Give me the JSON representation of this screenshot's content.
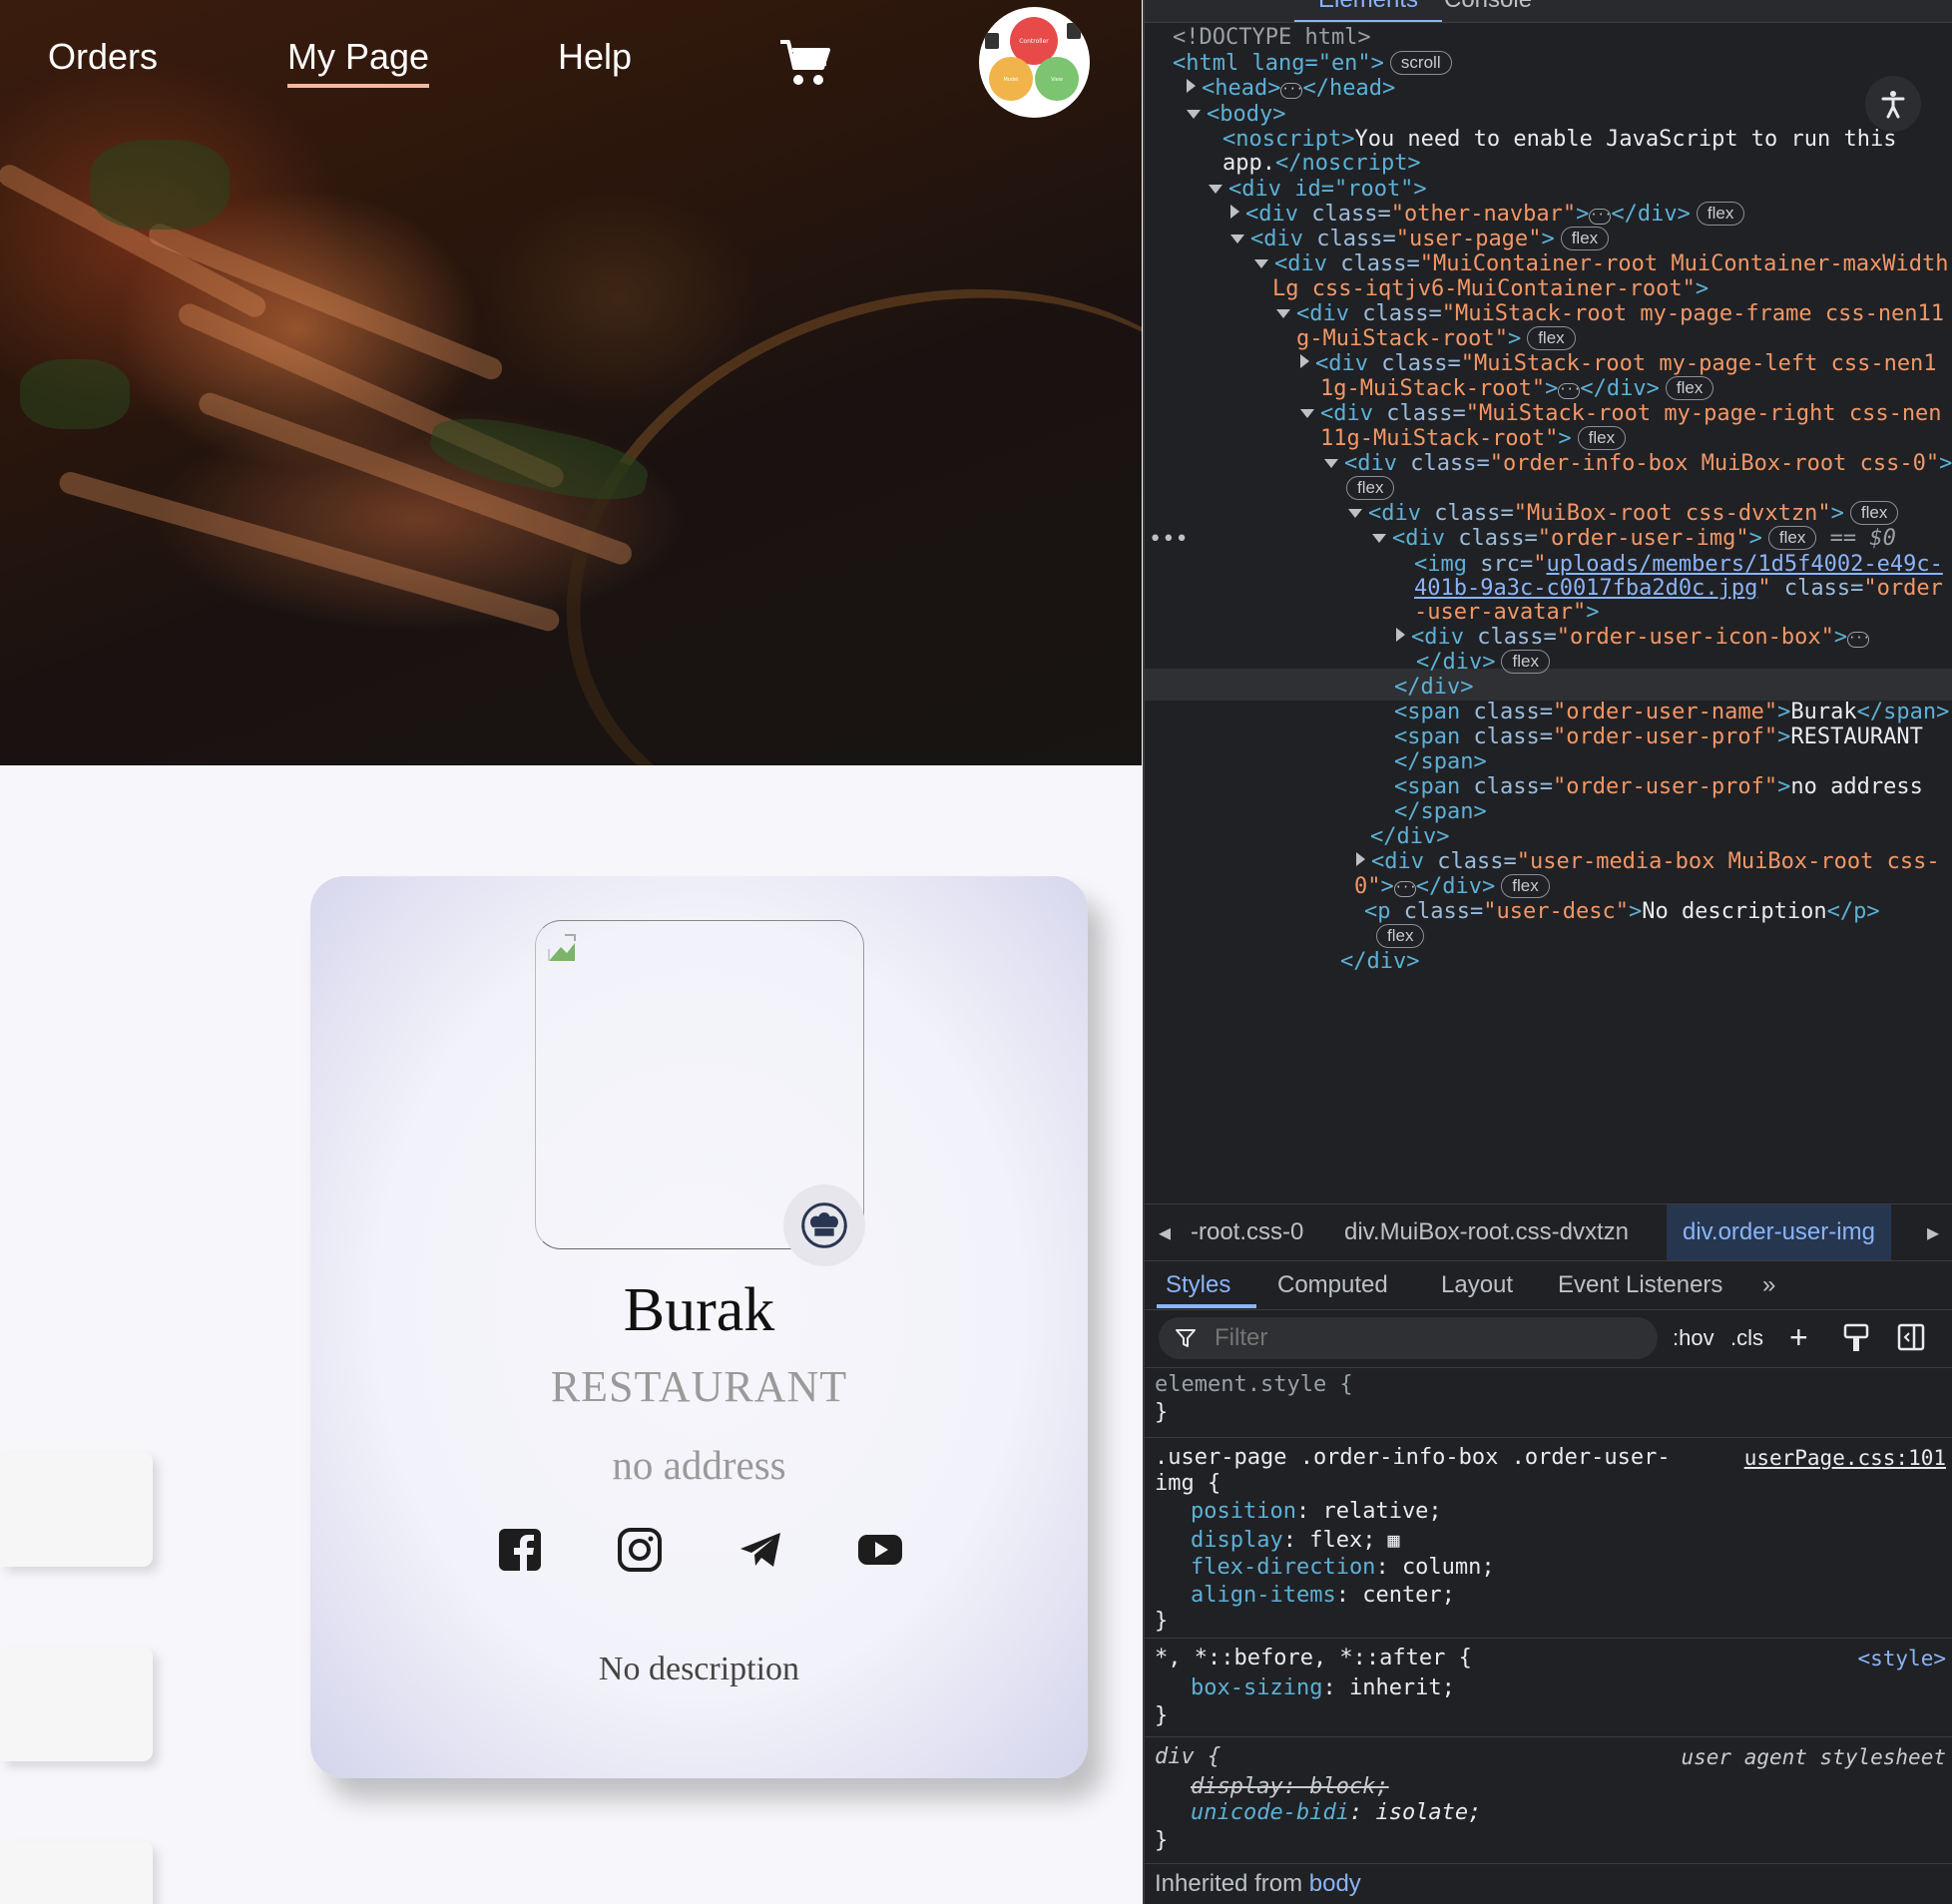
{
  "nav": {
    "items": [
      "Orders",
      "My Page",
      "Help"
    ],
    "active": "My Page",
    "cart_icon": "cart-icon",
    "logo_labels": [
      "Controller",
      "Model",
      "View"
    ]
  },
  "profile": {
    "name": "Burak",
    "profession": "RESTAURANT",
    "address": "no address",
    "description": "No description",
    "badge_icon": "chef-hat-icon",
    "social_icons": [
      "facebook-icon",
      "instagram-icon",
      "telegram-icon",
      "youtube-icon"
    ]
  },
  "devtools": {
    "tabs": [
      "Elements",
      "Console"
    ],
    "dom_lines": {
      "doctype": "<!DOCTYPE html>",
      "html_open": "<html lang=\"en\">",
      "scroll_badge": "scroll",
      "head": "<head>",
      "head_close": "</head>",
      "body": "<body>",
      "noscript_a": "You need to enable JavaScript to run this",
      "noscript_b": "app.",
      "root": "<div id=\"root\">",
      "navbar_class": "other-navbar",
      "user_page_class": "user-page",
      "container_a": "MuiContainer-root MuiContainer-maxWidth",
      "container_b": "Lg css-iqtjv6-MuiContainer-root",
      "frame_a": "MuiStack-root my-page-frame css-nen11",
      "frame_b": "g-MuiStack-root",
      "left_a": "MuiStack-root my-page-left css-nen1",
      "left_b": "1g-MuiStack-root",
      "right_a": "MuiStack-root my-page-right css-nen",
      "right_b": "11g-MuiStack-root",
      "info_box": "order-info-box MuiBox-root css-0",
      "dvxtzn": "MuiBox-root css-dvxtzn",
      "order_user_img": "order-user-img",
      "selected_marker": "== $0",
      "img_src_a": "uploads/members/1d5f4002-e49c-",
      "img_src_b": "401b-9a3c-c0017fba2d0c.jpg",
      "img_class_a": "order",
      "img_class_b": "-user-avatar",
      "icon_box": "order-user-icon-box",
      "name_class": "order-user-name",
      "name_text": "Burak",
      "prof_class": "order-user-prof",
      "prof_text": "RESTAURANT",
      "addr_text": "no address",
      "media_a": "user-media-box MuiBox-root css-",
      "media_b": "0",
      "desc_class": "user-desc",
      "desc_text": "No description",
      "flex_badge": "flex"
    },
    "breadcrumbs": [
      "-root.css-0",
      "div.MuiBox-root.css-dvxtzn",
      "div.order-user-img"
    ],
    "style_tabs": [
      "Styles",
      "Computed",
      "Layout",
      "Event Listeners"
    ],
    "active_style_tab": "Styles",
    "filter_placeholder": "Filter",
    "filter_tools": [
      ":hov",
      ".cls"
    ],
    "rules": {
      "element_style": "element.style {",
      "rule1_selector_a": ".user-page .order-info-box .order-user-",
      "rule1_selector_b": "img {",
      "rule1_source": "userPage.css:101",
      "rule1_props": [
        {
          "name": "position",
          "value": "relative;"
        },
        {
          "name": "display",
          "value": "flex;"
        },
        {
          "name": "flex-direction",
          "value": "column;"
        },
        {
          "name": "align-items",
          "value": "center;"
        }
      ],
      "rule2_selector": "*, *::before, *::after {",
      "rule2_source": "<style>",
      "rule2_prop": {
        "name": "box-sizing",
        "value": "inherit;"
      },
      "rule3_selector": "div {",
      "rule3_source": "user agent stylesheet",
      "rule3_struck": "display: block;",
      "rule3_prop": {
        "name": "unicode-bidi",
        "value": "isolate;"
      },
      "inherited_label": "Inherited from",
      "inherited_from": "body"
    }
  }
}
